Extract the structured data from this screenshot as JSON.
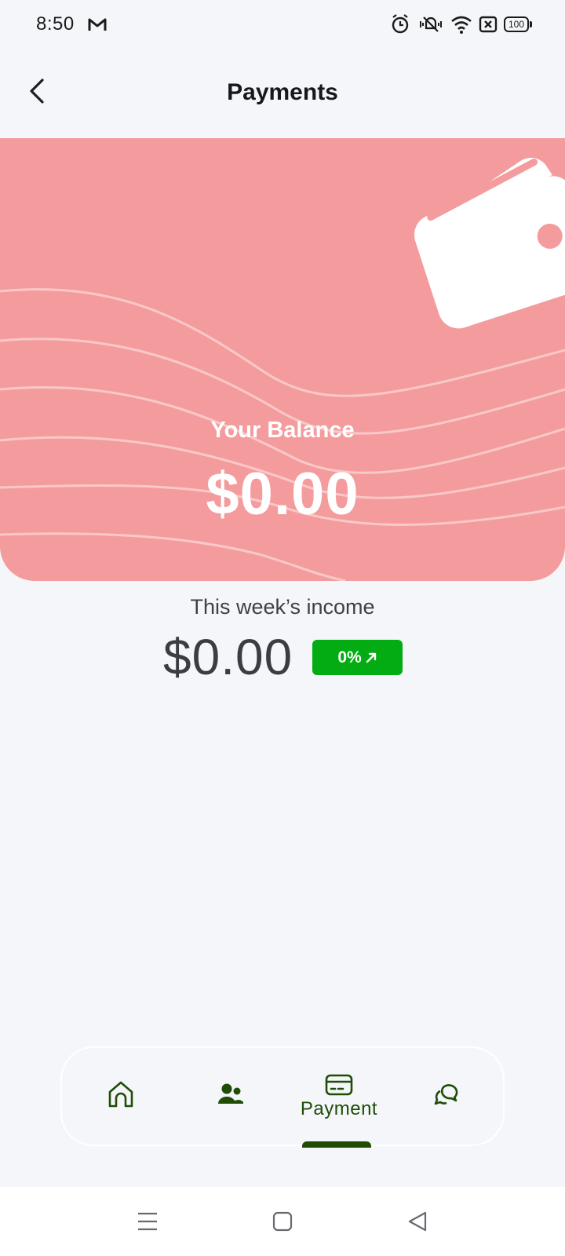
{
  "status_bar": {
    "time": "8:50",
    "battery": "100",
    "icons": [
      "gmail-icon",
      "alarm-icon",
      "vibrate-icon",
      "wifi-icon",
      "no-sim-icon",
      "battery-icon"
    ]
  },
  "header": {
    "title": "Payments",
    "back_icon": "chevron-left-icon"
  },
  "balance_card": {
    "label": "Your Balance",
    "amount": "$0.00",
    "background_color": "#f49c9d",
    "graphic": "wallet-icon"
  },
  "income": {
    "label": "This week’s income",
    "amount": "$0.00",
    "change_percent": "0%",
    "badge_color": "#03ac13",
    "trend_icon": "arrow-up-right-icon"
  },
  "bottom_nav": {
    "items": [
      {
        "icon": "home-icon",
        "label": ""
      },
      {
        "icon": "people-icon",
        "label": ""
      },
      {
        "icon": "credit-card-icon",
        "label": "Payment",
        "active": true
      },
      {
        "icon": "chat-icon",
        "label": ""
      }
    ],
    "active_color": "#1f4d06"
  },
  "system_nav": {
    "buttons": [
      "menu-icon",
      "home-square-icon",
      "back-triangle-icon"
    ]
  }
}
